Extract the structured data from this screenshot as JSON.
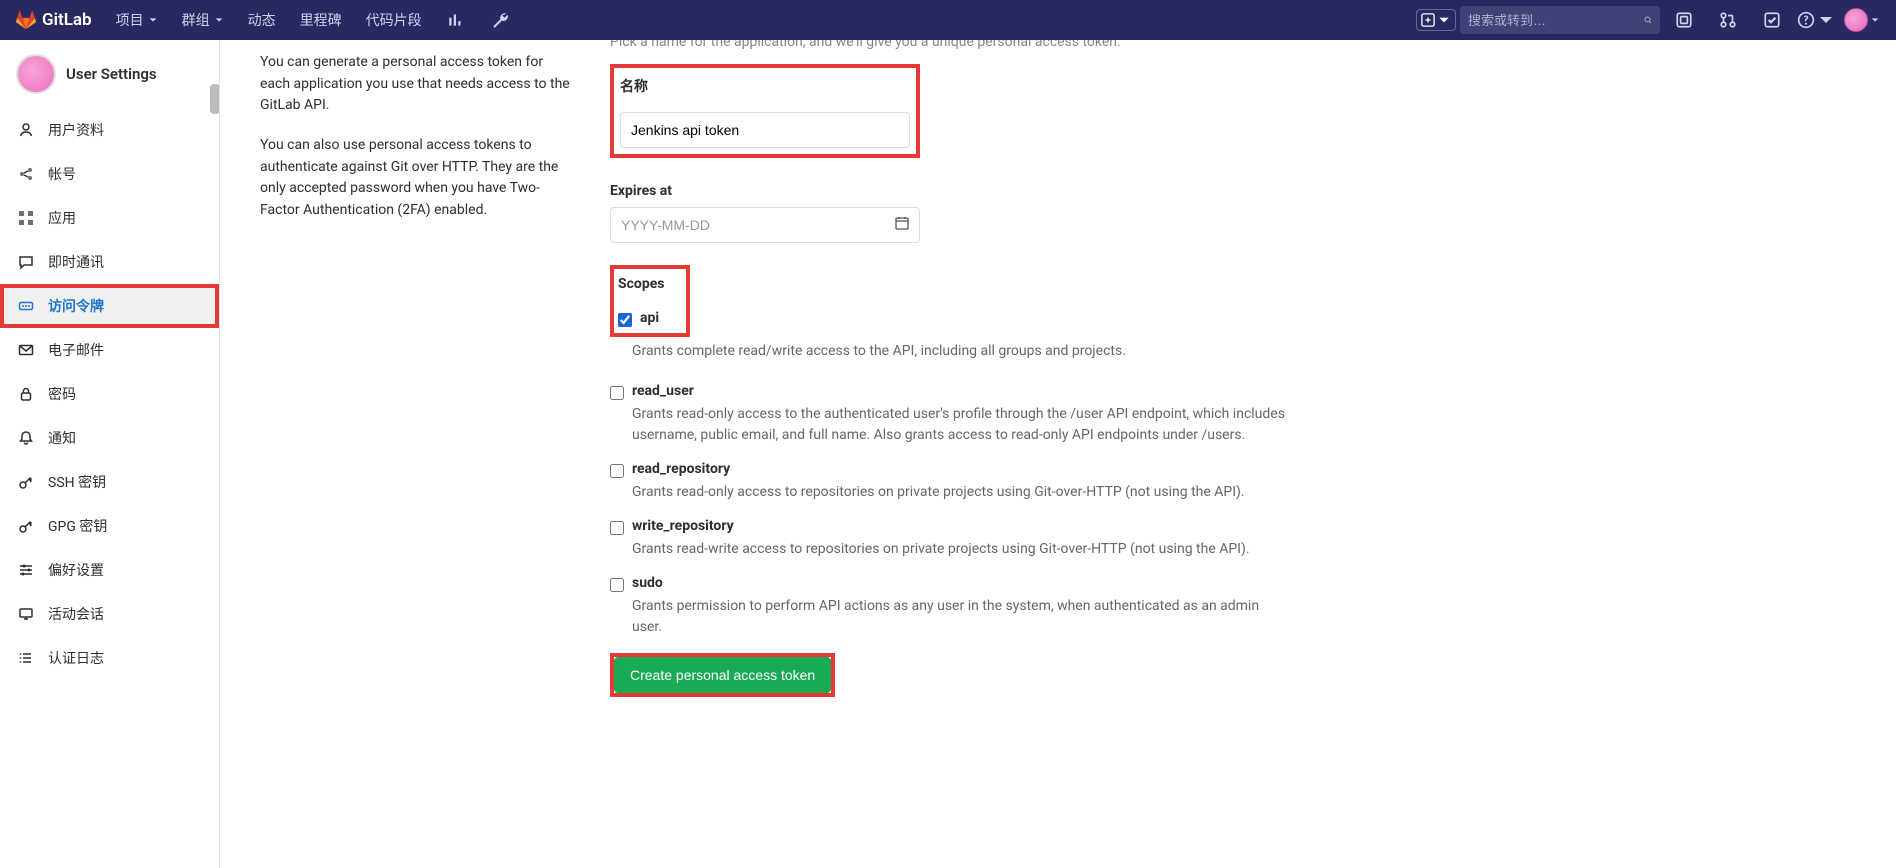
{
  "brand": "GitLab",
  "nav": {
    "project": "项目",
    "group": "群组",
    "activity": "动态",
    "milestones": "里程碑",
    "snippets": "代码片段"
  },
  "search_placeholder": "搜索或转到…",
  "sidebar": {
    "title": "User Settings",
    "items": {
      "profile": "用户资料",
      "account": "帐号",
      "apps": "应用",
      "chat": "即时通讯",
      "access_tokens": "访问令牌",
      "emails": "电子邮件",
      "password": "密码",
      "notifications": "通知",
      "ssh": "SSH 密钥",
      "gpg": "GPG 密钥",
      "prefs": "偏好设置",
      "sessions": "活动会话",
      "auth_log": "认证日志"
    }
  },
  "left": {
    "p1": "You can generate a personal access token for each application you use that needs access to the GitLab API.",
    "p2": "You can also use personal access tokens to authenticate against Git over HTTP. They are the only accepted password when you have Two-Factor Authentication (2FA) enabled."
  },
  "form": {
    "intro": "Pick a name for the application, and we'll give you a unique personal access token.",
    "name_label": "名称",
    "name_value": "Jenkins api token",
    "expires_label": "Expires at",
    "expires_placeholder": "YYYY-MM-DD",
    "scopes_label": "Scopes",
    "scopes": {
      "api": {
        "name": "api",
        "desc": "Grants complete read/write access to the API, including all groups and projects."
      },
      "read_user": {
        "name": "read_user",
        "desc": "Grants read-only access to the authenticated user's profile through the /user API endpoint, which includes username, public email, and full name. Also grants access to read-only API endpoints under /users."
      },
      "read_repository": {
        "name": "read_repository",
        "desc": "Grants read-only access to repositories on private projects using Git-over-HTTP (not using the API)."
      },
      "write_repository": {
        "name": "write_repository",
        "desc": "Grants read-write access to repositories on private projects using Git-over-HTTP (not using the API)."
      },
      "sudo": {
        "name": "sudo",
        "desc": "Grants permission to perform API actions as any user in the system, when authenticated as an admin user."
      }
    },
    "submit": "Create personal access token"
  }
}
